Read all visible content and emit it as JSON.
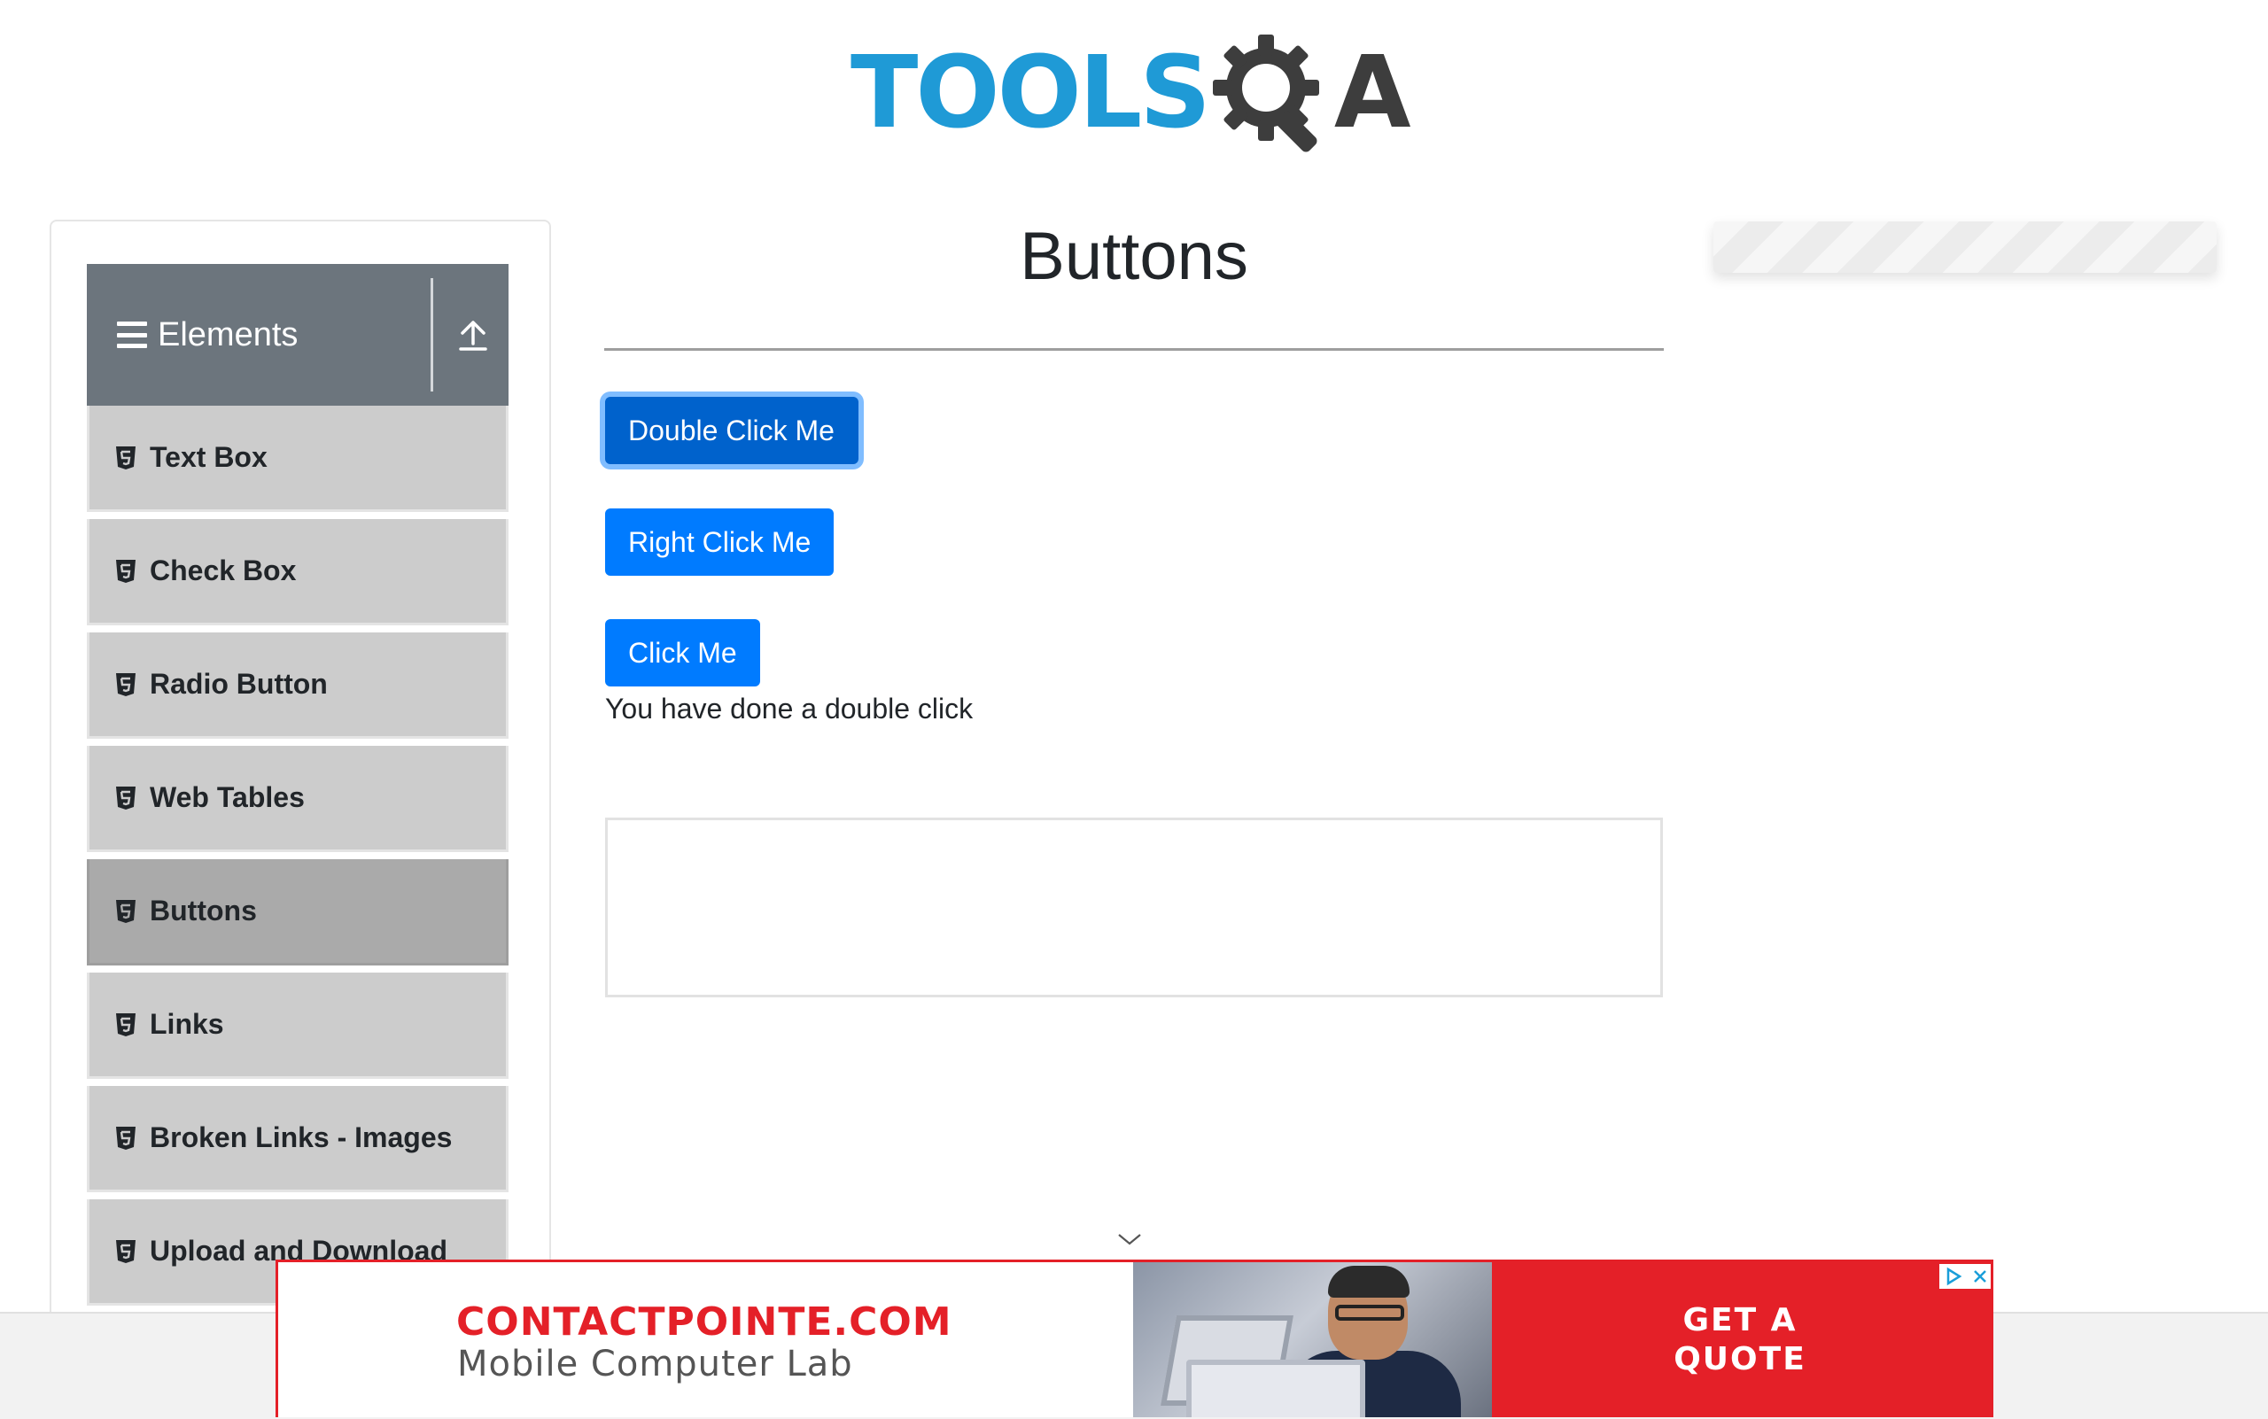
{
  "header": {
    "logo_tools": "TOOLS",
    "logo_qa_q_icon": "gear-magnifier-icon",
    "logo_a": "A"
  },
  "sidebar": {
    "group_title": "Elements",
    "group_icon": "hamburger-icon",
    "collapse_icon": "upload-arrow-icon",
    "items": [
      {
        "label": "Text Box",
        "active": false
      },
      {
        "label": "Check Box",
        "active": false
      },
      {
        "label": "Radio Button",
        "active": false
      },
      {
        "label": "Web Tables",
        "active": false
      },
      {
        "label": "Buttons",
        "active": true
      },
      {
        "label": "Links",
        "active": false
      },
      {
        "label": "Broken Links - Images",
        "active": false
      },
      {
        "label": "Upload and Download",
        "active": false
      }
    ]
  },
  "main": {
    "page_title": "Buttons",
    "double_click_label": "Double Click Me",
    "right_click_label": "Right Click Me",
    "click_label": "Click Me",
    "message": "You have done a double click"
  },
  "ad": {
    "brand": "CONTACTPOINTE.COM",
    "subtitle": "Mobile Computer Lab",
    "cta_line1": "GET A",
    "cta_line2": "QUOTE"
  },
  "colors": {
    "button_primary": "#007bff",
    "button_focused": "#0062cc",
    "sidebar_header": "#6c757d",
    "sidebar_item": "#cccccc",
    "sidebar_item_active": "#aaaaaa",
    "logo_blue": "#1f9ad6",
    "ad_red": "#e42028"
  }
}
